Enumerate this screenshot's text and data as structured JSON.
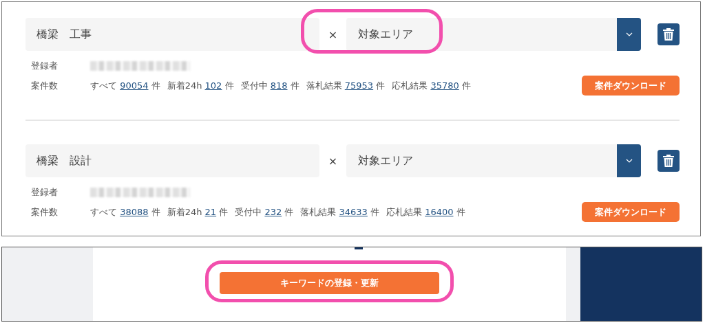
{
  "entries": [
    {
      "keyword": "橋梁　工事",
      "separator": "×",
      "area": "対象エリア",
      "highlighted": true,
      "registrant_label": "登録者",
      "count_label": "案件数",
      "counts": [
        {
          "label": "すべて",
          "value": "90054",
          "unit": "件"
        },
        {
          "label": "新着24h",
          "value": "102",
          "unit": "件"
        },
        {
          "label": "受付中",
          "value": "818",
          "unit": "件"
        },
        {
          "label": "落札結果",
          "value": "75953",
          "unit": "件"
        },
        {
          "label": "応札結果",
          "value": "35780",
          "unit": "件"
        }
      ],
      "download_button": "案件ダウンロード"
    },
    {
      "keyword": "橋梁　設計",
      "separator": "×",
      "area": "対象エリア",
      "highlighted": false,
      "registrant_label": "登録者",
      "count_label": "案件数",
      "counts": [
        {
          "label": "すべて",
          "value": "38088",
          "unit": "件"
        },
        {
          "label": "新着24h",
          "value": "21",
          "unit": "件"
        },
        {
          "label": "受付中",
          "value": "232",
          "unit": "件"
        },
        {
          "label": "落札結果",
          "value": "34633",
          "unit": "件"
        },
        {
          "label": "応札結果",
          "value": "16400",
          "unit": "件"
        }
      ],
      "download_button": "案件ダウンロード"
    }
  ],
  "submit": {
    "label": "キーワードの登録・更新",
    "highlighted": true
  }
}
